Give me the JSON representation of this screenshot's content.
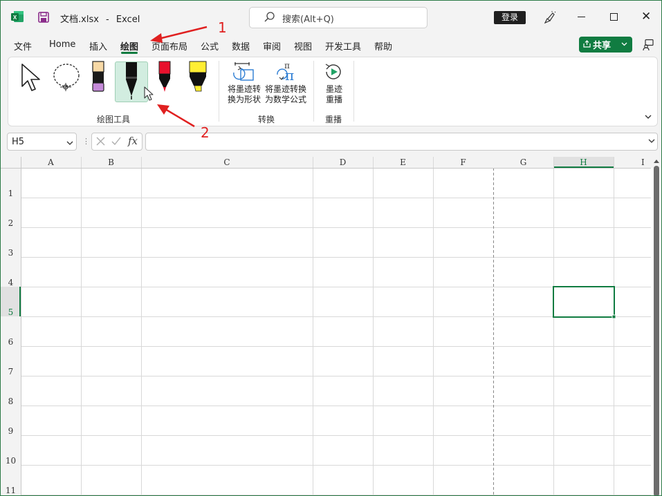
{
  "window": {
    "file_name": "文档.xlsx",
    "separator": "-",
    "app_name": "Excel"
  },
  "search": {
    "placeholder": "搜索(Alt+Q)"
  },
  "account": {
    "login_label": "登录"
  },
  "tabs": [
    "文件",
    "Home",
    "插入",
    "绘图",
    "页面布局",
    "公式",
    "数据",
    "审阅",
    "视图",
    "开发工具",
    "帮助"
  ],
  "active_tab": "绘图",
  "share": {
    "label": "共享"
  },
  "ribbon": {
    "groups": [
      {
        "label": "绘图工具"
      },
      {
        "label": "转换",
        "buttons": [
          "将墨迹转\n换为形状",
          "将墨迹转换\n为数学公式"
        ]
      },
      {
        "label": "重播",
        "buttons": [
          "墨迹\n重播"
        ]
      }
    ]
  },
  "formula_bar": {
    "name_box": "H5",
    "formula": ""
  },
  "sheet": {
    "columns": [
      "A",
      "B",
      "C",
      "D",
      "E",
      "F",
      "G",
      "H",
      "I"
    ],
    "rows": [
      "1",
      "2",
      "3",
      "4",
      "5",
      "6",
      "7",
      "8",
      "9",
      "10",
      "11"
    ],
    "selected_cell": "H5"
  },
  "annotations": [
    "1",
    "2"
  ],
  "colors": {
    "accent": "#107c41",
    "annotation": "#e02020"
  }
}
